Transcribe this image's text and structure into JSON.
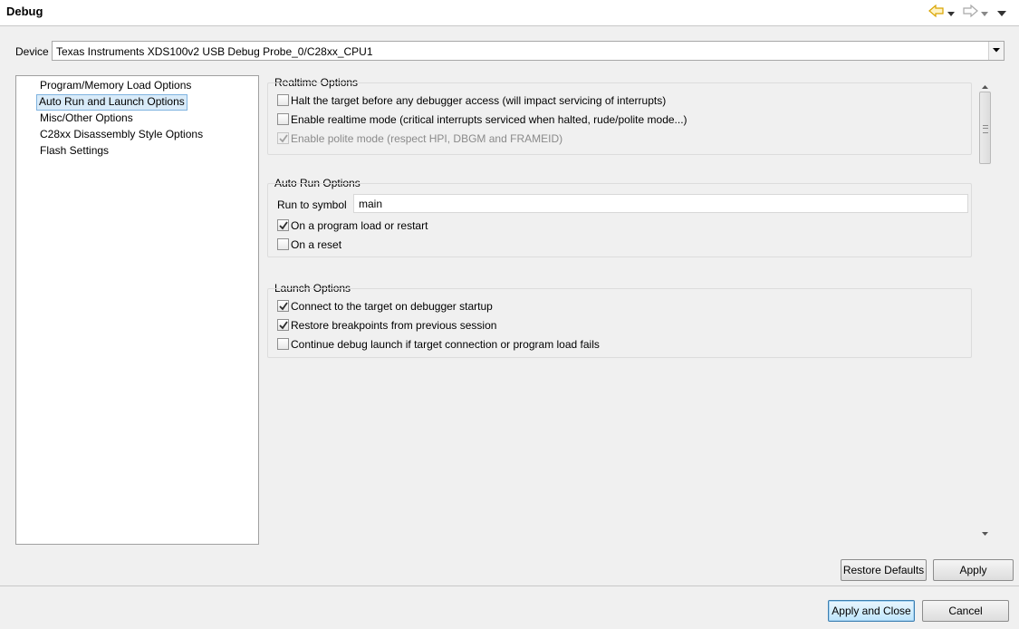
{
  "header": {
    "title": "Debug"
  },
  "device": {
    "label": "Device",
    "selected": "Texas Instruments XDS100v2 USB Debug Probe_0/C28xx_CPU1"
  },
  "tree": {
    "items": [
      {
        "label": "Program/Memory Load Options",
        "selected": false
      },
      {
        "label": "Auto Run and Launch Options",
        "selected": true
      },
      {
        "label": "Misc/Other Options",
        "selected": false
      },
      {
        "label": "C28xx Disassembly Style Options",
        "selected": false
      },
      {
        "label": "Flash Settings",
        "selected": false
      }
    ]
  },
  "realtime": {
    "title": "Realtime Options",
    "options": [
      {
        "label": "Halt the target before any debugger access (will impact servicing of interrupts)",
        "checked": false,
        "enabled": true
      },
      {
        "label": "Enable realtime mode (critical interrupts serviced when halted, rude/polite mode...)",
        "checked": false,
        "enabled": true
      },
      {
        "label": "Enable polite mode (respect HPI, DBGM and FRAMEID)",
        "checked": true,
        "enabled": false
      }
    ]
  },
  "autorun": {
    "title": "Auto Run Options",
    "run_to_symbol_label": "Run to symbol",
    "run_to_symbol_value": "main",
    "options": [
      {
        "label": "On a program load or restart",
        "checked": true,
        "enabled": true
      },
      {
        "label": "On a reset",
        "checked": false,
        "enabled": true
      }
    ]
  },
  "launch": {
    "title": "Launch Options",
    "options": [
      {
        "label": "Connect to the target on debugger startup",
        "checked": true,
        "enabled": true
      },
      {
        "label": "Restore breakpoints from previous session",
        "checked": true,
        "enabled": true
      },
      {
        "label": "Continue debug launch if target connection or program load fails",
        "checked": false,
        "enabled": true
      }
    ]
  },
  "buttons": {
    "restore_defaults": "Restore Defaults",
    "apply": "Apply",
    "apply_and_close": "Apply and Close",
    "cancel": "Cancel"
  },
  "icons": {
    "back": "arrow-left-icon",
    "forward": "arrow-right-icon",
    "menu": "view-menu-icon"
  },
  "colors": {
    "back_arrow": "#e0a800",
    "forward_arrow": "#a8a8a8",
    "selection_bg": "#d9ebf9",
    "selection_border": "#7fb3e0"
  }
}
